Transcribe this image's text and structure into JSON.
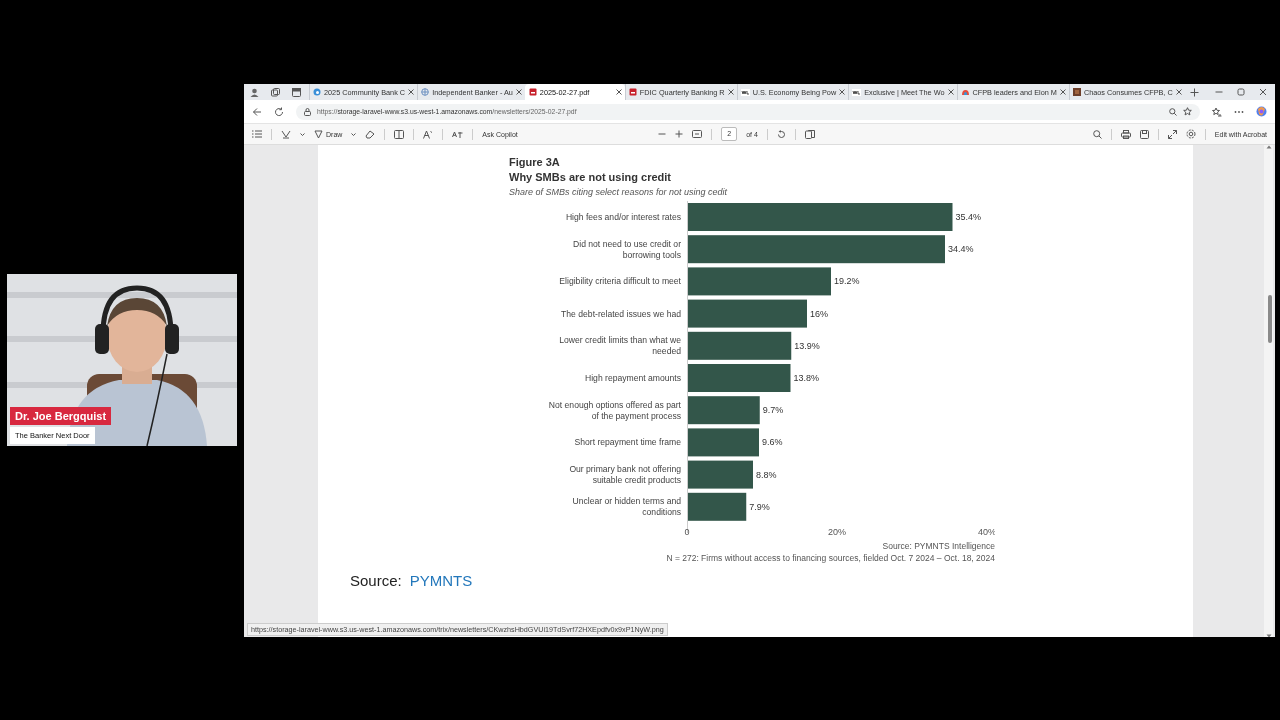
{
  "webcam": {
    "name": "Dr. Joe Bergquist",
    "show": "The Banker Next Door"
  },
  "browser": {
    "tabs": [
      {
        "title": "2025 Community Bank C",
        "kind": "edge",
        "selected": false
      },
      {
        "title": "Independent Banker - Au",
        "kind": "globe",
        "selected": false
      },
      {
        "title": "2025-02-27.pdf",
        "kind": "pdf",
        "selected": true
      },
      {
        "title": "FDIC Quarterly Banking R",
        "kind": "pdf",
        "selected": false
      },
      {
        "title": "U.S. Economy Being Pow",
        "kind": "news",
        "selected": false
      },
      {
        "title": "Exclusive | Meet The Wo",
        "kind": "news",
        "selected": false
      },
      {
        "title": "CFPB leaders and Elon M",
        "kind": "colorful",
        "selected": false
      },
      {
        "title": "Chaos Consumes CFPB, C",
        "kind": "thumb",
        "selected": false
      }
    ],
    "address": {
      "url": "https://**storage-laravel-www.s3.us-west-1.amazonaws.com**/newsletters/2025-02-27.pdf"
    },
    "pdf_toolbar": {
      "draw_label": "Draw",
      "copilot_label": "Ask Copilot",
      "page": "2",
      "page_count": "of 4",
      "acrobat_label": "Edit with Acrobat"
    },
    "document": {
      "figure_label": "Figure 3A",
      "title": "Why SMBs are not using credit",
      "subtitle": "Share of SMBs citing select reasons for not using cedit",
      "chart_data": {
        "type": "bar",
        "orientation": "horizontal",
        "categories": [
          "High fees and/or interest rates",
          "Did not need to use credit or\nborrowing tools",
          "Eligibility criteria difficult to meet",
          "The debt-related issues we had",
          "Lower credit limits than what we\nneeded",
          "High repayment amounts",
          "Not enough options offered as part\nof the payment process",
          "Short repayment time frame",
          "Our primary bank not offering\nsuitable credit products",
          "Unclear or hidden terms and\nconditions"
        ],
        "series": [
          {
            "color": "#33564a",
            "values": [
              35.4,
              34.4,
              19.2,
              16,
              13.9,
              13.8,
              9.7,
              9.6,
              8.8,
              7.9
            ]
          }
        ],
        "value_labels": [
          "35.4%",
          "34.4%",
          "19.2%",
          "16%",
          "13.9%",
          "13.8%",
          "9.7%",
          "9.6%",
          "8.8%",
          "7.9%"
        ],
        "xlim": [
          0,
          40
        ],
        "xticks": [
          {
            "value": 0,
            "label": "0"
          },
          {
            "value": 20,
            "label": "20%"
          },
          {
            "value": 40,
            "label": "40%"
          }
        ]
      },
      "source_line": "Source: PYMNTS Intelligence",
      "sample_note": "N = 272: Firms without access to financing sources, fielded Oct. 7 2024 – Oct. 18, 2024",
      "source_label": "Source:",
      "source_link": "PYMNTS"
    },
    "status_url": "https://storage-laravel-www.s3.us-west-1.amazonaws.com/trix/newsletters/CKwzhsHbdGVUi19TdSvrf72HXEpdfv0x9xP1NyW.png"
  }
}
